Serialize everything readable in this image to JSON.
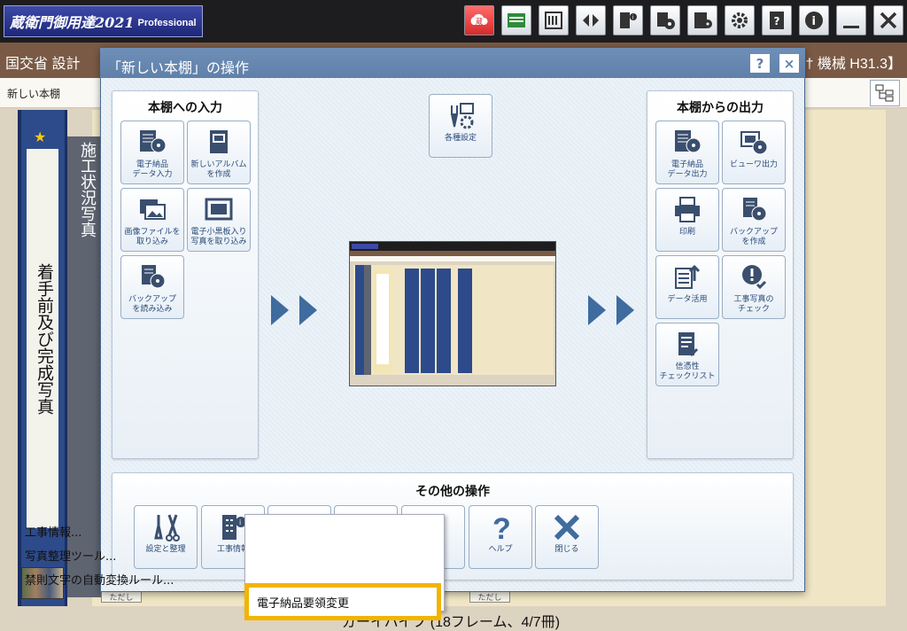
{
  "app": {
    "logo_main": "蔵衛門御用達2021",
    "logo_sub": "Professional"
  },
  "toolbar": {
    "icons": [
      "kura-icon",
      "photo-window-icon",
      "building-icon",
      "split-view-icon",
      "construction-info-icon",
      "disc-icon",
      "calculator-icon",
      "gear-icon",
      "help-book-icon",
      "info-icon",
      "minimize-icon",
      "close-icon"
    ]
  },
  "project": {
    "left": "国交省 設計",
    "right": "† 機械 H31.3】"
  },
  "subbar": {
    "title": "新しい本棚"
  },
  "shelf": {
    "book1_title": "着手前及び完成写真",
    "book2_title": "施工状況写真",
    "caption": "ガーイハイフ (18フレーム、4/7冊)",
    "mini_label": "ただし"
  },
  "dialog": {
    "title": "「新しい本棚」の操作",
    "help": "?",
    "close": "×",
    "settings_button": "各種設定",
    "input_panel": {
      "title": "本棚への入力",
      "buttons": [
        {
          "label": "電子納品\nデータ入力",
          "icon": "disc-doc-icon"
        },
        {
          "label": "新しいアルバム\nを作成",
          "icon": "album-icon"
        },
        {
          "label": "画像ファイルを\n取り込み",
          "icon": "image-files-icon"
        },
        {
          "label": "電子小黒板入り\n写真を取り込み",
          "icon": "blackboard-icon"
        },
        {
          "label": "バックアップ\nを読み込み",
          "icon": "backup-load-icon"
        }
      ]
    },
    "output_panel": {
      "title": "本棚からの出力",
      "buttons": [
        {
          "label": "電子納品\nデータ出力",
          "icon": "disc-doc-icon"
        },
        {
          "label": "ビューワ出力",
          "icon": "viewer-icon"
        },
        {
          "label": "印刷",
          "icon": "printer-icon"
        },
        {
          "label": "バックアップ\nを作成",
          "icon": "backup-create-icon"
        },
        {
          "label": "データ活用",
          "icon": "data-use-icon"
        },
        {
          "label": "工事写真の\nチェック",
          "icon": "photo-check-icon"
        },
        {
          "label": "信憑性\nチェックリスト",
          "icon": "checklist-icon"
        }
      ]
    },
    "other_panel": {
      "title": "その他の操作",
      "buttons": [
        {
          "label": "設定と整理",
          "icon": "tools-icon"
        },
        {
          "label": "工事情報",
          "icon": "building-info-icon"
        },
        {
          "label": "",
          "icon": "blank-icon"
        },
        {
          "label": "",
          "icon": "blank-icon"
        },
        {
          "label": "ン\nス",
          "icon": "upload-icon"
        },
        {
          "label": "ヘルプ",
          "icon": "help-icon"
        },
        {
          "label": "閉じる",
          "icon": "close-x-icon"
        }
      ]
    }
  },
  "context_menu": {
    "items": [
      "工事情報...",
      "写真整理ツール...",
      "禁則文字の自動変換ルール...",
      "電子納品要領変更"
    ],
    "highlighted": "電子納品要領変更"
  },
  "colors": {
    "accent": "#5f80a9",
    "highlight": "#f2b400",
    "title_bar": "#6f8fb7"
  }
}
